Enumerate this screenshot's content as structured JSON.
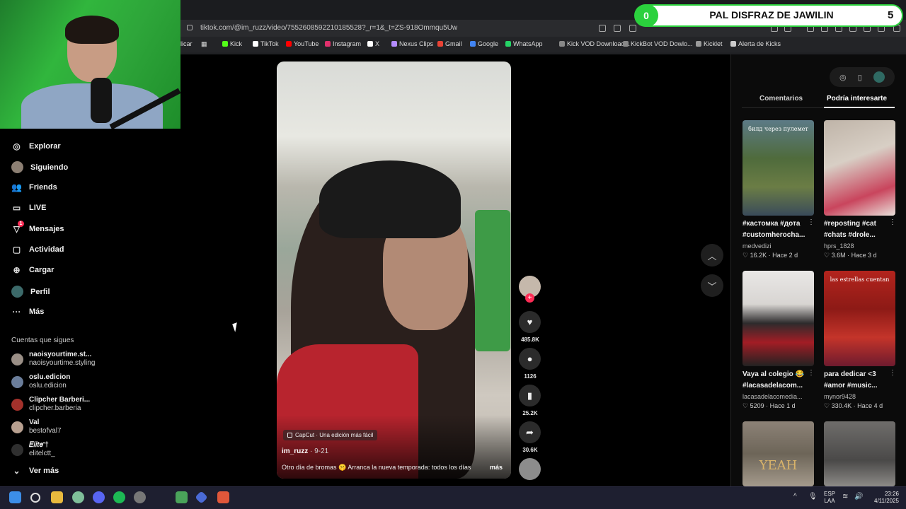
{
  "browser": {
    "url": "tiktok.com/@im_ruzz/video/7552608592210185528?_r=1&_t=ZS-918Ommqu5Uw",
    "bookmarks": [
      {
        "label": "Kick",
        "color": "#53fc18"
      },
      {
        "label": "TikTok",
        "color": "#ffffff"
      },
      {
        "label": "YouTube",
        "color": "#ff0000"
      },
      {
        "label": "Instagram",
        "color": "#e1306c"
      },
      {
        "label": "X",
        "color": "#ffffff"
      },
      {
        "label": "Nexus Clips",
        "color": "#b48cff"
      },
      {
        "label": "Gmail",
        "color": "#ea4335"
      },
      {
        "label": "Google",
        "color": "#4285f4"
      },
      {
        "label": "WhatsApp",
        "color": "#25d366"
      },
      {
        "label": "Kick VOD Download...",
        "color": "#888888"
      },
      {
        "label": "KickBot VOD Dowlo...",
        "color": "#888888"
      },
      {
        "label": "Kicklet",
        "color": "#9a9a9a"
      },
      {
        "label": "Alerta de Kicks",
        "color": "#cccccc"
      }
    ],
    "bookmark_partial": "licar"
  },
  "score_overlay": {
    "left_value": "0",
    "title": "PAL DISFRAZ DE JAWILIN",
    "right_value": "5"
  },
  "sidebar": {
    "nav": [
      {
        "label": "Explorar",
        "icon": "compass-icon"
      },
      {
        "label": "Siguiendo",
        "icon": "avatar"
      },
      {
        "label": "Friends",
        "icon": "friends-icon"
      },
      {
        "label": "LIVE",
        "icon": "live-icon"
      },
      {
        "label": "Mensajes",
        "icon": "messages-icon",
        "badge": "1"
      },
      {
        "label": "Actividad",
        "icon": "activity-icon"
      },
      {
        "label": "Cargar",
        "icon": "upload-icon"
      },
      {
        "label": "Perfil",
        "icon": "avatar"
      },
      {
        "label": "Más",
        "icon": "more-icon"
      }
    ],
    "following_title": "Cuentas que sigues",
    "accounts": [
      {
        "name": "naoisyourtime.st...",
        "handle": "naoisyourtime.styling",
        "color": "#9a8f86"
      },
      {
        "name": "oslu.edicion",
        "handle": "oslu.edicion",
        "color": "#6a7d9a"
      },
      {
        "name": "Clipcher Barberi...",
        "handle": "clipcher.barberia",
        "color": "#a3312b"
      },
      {
        "name": "Val",
        "handle": "bestofval7",
        "color": "#b8a090"
      },
      {
        "name": "𝐸𝑙𝑖𝑡𝑒'†",
        "handle": "elitelctt_",
        "color": "#2f2f2f"
      }
    ],
    "see_more": "Ver más"
  },
  "video": {
    "capcut_label": "CapCut · Una edición más fácil",
    "author": "im_ruzz",
    "date": " · 9-21",
    "description": "Otro día de bromas 🤫 Arranca la nueva temporada: todos los días",
    "more": "más"
  },
  "actions": {
    "likes": "485.8K",
    "comments": "1126",
    "saves": "25.2K",
    "shares": "30.6K"
  },
  "right_panel": {
    "tabs": [
      "Comentarios",
      "Podría interesarte"
    ],
    "cards": [
      {
        "title1": "#кастомка #дота",
        "title2": "#customherocha...",
        "user": "medvedizi",
        "views": "16.2K",
        "when": "Hace 2 d",
        "bg": "linear-gradient(180deg,#5c7a86 0%,#4f6b3c 40%,#6b7d45 70%,#3a4b5a 100%)",
        "overlay": "билд через пулемет"
      },
      {
        "title1": "#reposting #cat",
        "title2": "#chats #drole...",
        "user": "hprs_1828",
        "views": "3.6M",
        "when": "Hace 3 d",
        "bg": "linear-gradient(160deg,#bfb4a8 0%,#d8cfc5 40%,#c9455d 75%,#e9e0da 100%)",
        "overlay": ""
      },
      {
        "title1": "Vaya al colegio 😂",
        "title2": "#lacasadelacom...",
        "user": "lacasadelacomedia...",
        "views": "5209",
        "when": "Hace 1 d",
        "bg": "linear-gradient(180deg,#e9e7e6 0%,#d8d5d2 35%,#2d2b2c 55%,#a21d25 75%,#222 100%)",
        "overlay": ""
      },
      {
        "title1": "para dedicar <3",
        "title2": "#amor #music...",
        "user": "mynor9428",
        "views": "330.4K",
        "when": "Hace 4 d",
        "bg": "linear-gradient(180deg,#b3241d 0%,#8d1a16 40%,#c4342a 70%,#6e1b2e 100%)",
        "overlay": "las estrellas cuentan"
      },
      {
        "title1": "",
        "title2": "",
        "user": "",
        "views": "",
        "when": "",
        "bg": "linear-gradient(180deg,#8c8277 0%,#6d6558 50%,#a49a8c 100%)",
        "overlay": "YEAH"
      },
      {
        "title1": "",
        "title2": "",
        "user": "",
        "views": "",
        "when": "",
        "bg": "linear-gradient(180deg,#6f6d6b 0%,#4a4948 60%,#8c8a87 100%)",
        "overlay": ""
      }
    ]
  },
  "taskbar": {
    "lang1": "ESP",
    "lang2": "LAA",
    "time": "23:26",
    "date": "4/11/2025"
  }
}
